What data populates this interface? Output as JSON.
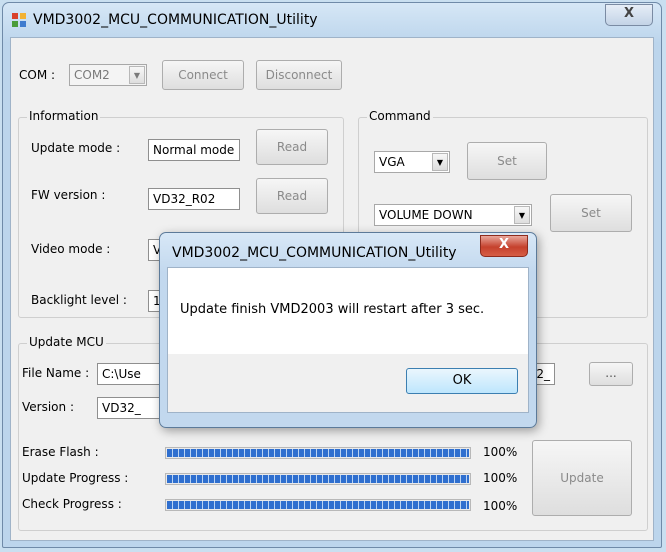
{
  "window": {
    "title": "VMD3002_MCU_COMMUNICATION_Utility",
    "close_glyph": "X"
  },
  "com": {
    "label": "COM :",
    "selected": "COM2",
    "connect": "Connect",
    "disconnect": "Disconnect"
  },
  "information": {
    "title": "Information",
    "update_mode_label": "Update mode :",
    "update_mode_value": "Normal mode",
    "update_mode_read": "Read",
    "fw_version_label": "FW version :",
    "fw_version_value": "VD32_R02",
    "fw_version_read": "Read",
    "video_mode_label": "Video mode :",
    "video_mode_value": "V",
    "backlight_label": "Backlight level :",
    "backlight_value": "1"
  },
  "command": {
    "title": "Command",
    "source_selected": "VGA",
    "source_set": "Set",
    "action_selected": "VOLUME DOWN",
    "action_set": "Set"
  },
  "update_mcu": {
    "title": "Update MCU",
    "file_name_label": "File Name :",
    "file_name_value": "C:\\Use",
    "file_name_tail": "D32_",
    "browse": "...",
    "version_label": "Version :",
    "version_value": "VD32_",
    "erase_label": "Erase Flash :",
    "erase_percent": "100%",
    "erase_level": 1.0,
    "update_label": "Update Progress :",
    "update_percent": "100%",
    "update_level": 1.0,
    "check_label": "Check Progress :",
    "check_percent": "100%",
    "check_level": 1.0,
    "update_button": "Update"
  },
  "dialog": {
    "title": "VMD3002_MCU_COMMUNICATION_Utility",
    "close_glyph": "X",
    "message": "Update finish VMD2003 will restart after 3 sec.",
    "ok": "OK"
  },
  "colors": {
    "progress": "#2f6fcf",
    "dialog_close": "#c5412d"
  }
}
